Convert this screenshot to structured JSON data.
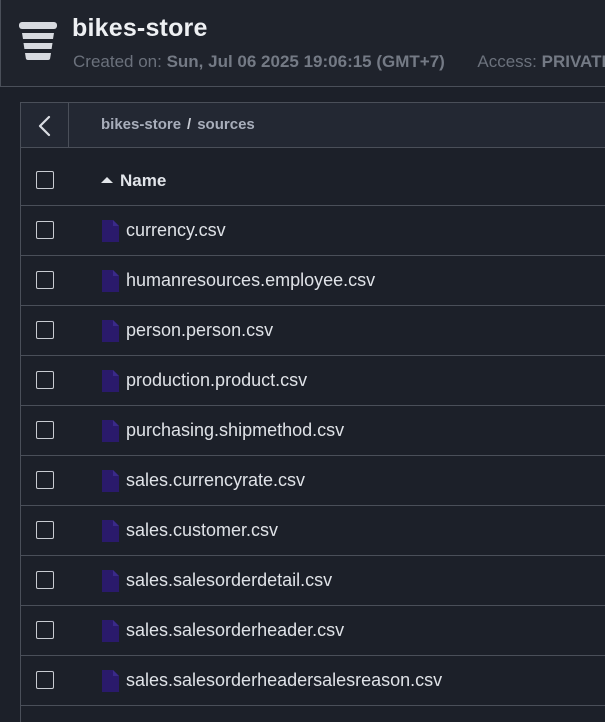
{
  "bucket": {
    "name": "bikes-store",
    "created_label": "Created on:",
    "created_value": "Sun, Jul 06 2025 19:06:15 (GMT+7)",
    "access_label": "Access:",
    "access_value": "PRIVATE"
  },
  "breadcrumb": {
    "root": "bikes-store",
    "separator": "/",
    "current": "sources"
  },
  "table": {
    "name_column": "Name",
    "sort_direction": "ascending",
    "files": [
      {
        "name": "currency.csv"
      },
      {
        "name": "humanresources.employee.csv"
      },
      {
        "name": "person.person.csv"
      },
      {
        "name": "production.product.csv"
      },
      {
        "name": "purchasing.shipmethod.csv"
      },
      {
        "name": "sales.currencyrate.csv"
      },
      {
        "name": "sales.customer.csv"
      },
      {
        "name": "sales.salesorderdetail.csv"
      },
      {
        "name": "sales.salesorderheader.csv"
      },
      {
        "name": "sales.salesorderheadersalesreason.csv"
      }
    ]
  },
  "colors": {
    "file_icon": "#2a1a6b",
    "background": "#1c2029",
    "border": "#4a4f59"
  },
  "icons": {
    "bucket": "bucket-icon",
    "back": "chevron-left-icon",
    "sort": "sort-ascending-icon",
    "file": "file-icon"
  }
}
